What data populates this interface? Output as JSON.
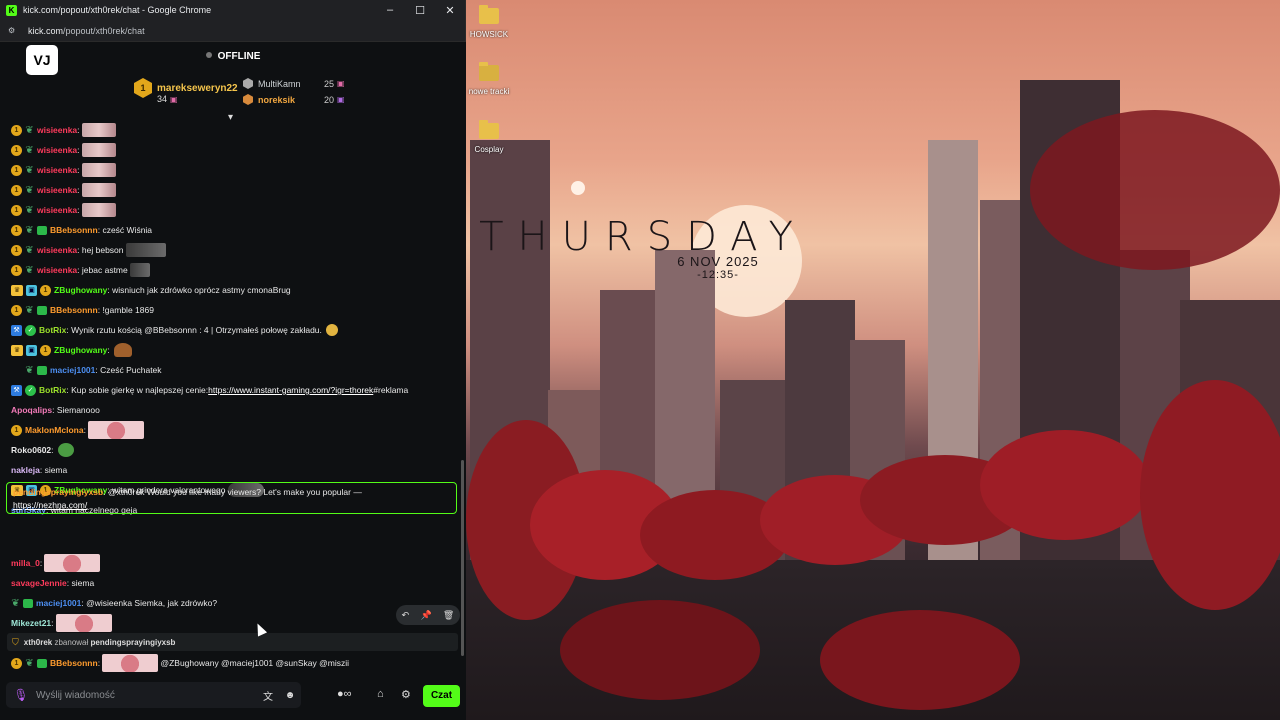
{
  "browser": {
    "title": "kick.com/popout/xth0rek/chat - Google Chrome",
    "url_host": "kick.com",
    "url_path": "/popout/xth0rek/chat"
  },
  "chat_header": {
    "status": "OFFLINE",
    "logo_text": "VJ"
  },
  "leaderboard": {
    "first": {
      "rank": "1",
      "name": "marekseweryn22",
      "points": "34"
    },
    "second": {
      "name": "MultiKamn",
      "points": "25"
    },
    "third": {
      "name": "noreksik",
      "points": "20"
    }
  },
  "messages": [
    {
      "user": "wisieenka",
      "text": ""
    },
    {
      "user": "wisieenka",
      "text": ""
    },
    {
      "user": "wisieenka",
      "text": ""
    },
    {
      "user": "wisieenka",
      "text": ""
    },
    {
      "user": "wisieenka",
      "text": ""
    },
    {
      "user": "BBebsonnn",
      "text": "cześć Wiśnia"
    },
    {
      "user": "wisieenka",
      "text": "hej bebson"
    },
    {
      "user": "wisieenka",
      "text": "jebac astme"
    },
    {
      "user": "ZBughowany",
      "text": "wisniuch jak zdrówko oprócz astmy cmonaBrug"
    },
    {
      "user": "BBebsonnn",
      "text": "!gamble 1869"
    },
    {
      "user": "BotRix",
      "text": "Wynik rzutu kością @BBebsonnn : 4 | Otrzymałeś połowę zakładu."
    },
    {
      "user": "ZBughowany",
      "text": ""
    },
    {
      "user": "maciej1001",
      "text": "Cześć Puchatek"
    },
    {
      "user": "BotRix",
      "text": "Kup sobie gierkę w najlepszej cenie: ",
      "link": "https://www.instant-gaming.com/?igr=thorek",
      "suffix": " #reklama"
    },
    {
      "user": "Apoqalips",
      "text": "Siemanooo"
    },
    {
      "user": "MaklonMclona",
      "text": ""
    },
    {
      "user": "Roko0602",
      "text": ""
    },
    {
      "user": "nakleja",
      "text": "siema"
    },
    {
      "user": "ZBughowany",
      "text": "witam grindera valorantowego"
    },
    {
      "user": "sunSkay",
      "text": "witam naczelnego geja"
    },
    {
      "user": "milla_0",
      "text": ""
    },
    {
      "user": "savageJennie",
      "text": "siema"
    },
    {
      "user": "maciej1001",
      "text": "@wisieenka Siemka, jak zdrówko?"
    },
    {
      "user": "Mikezet21",
      "text": ""
    },
    {
      "user": "BBebsonnn",
      "text": "@ZBughowany @maciej1001 @sunSkay @miszii"
    }
  ],
  "highlight": {
    "user": "pendingsprayingiyxsb",
    "text": "@xth0rek Would you like many viewers? Let's make you popular —",
    "link": "https://nezhna.com/"
  },
  "ban_notice": {
    "moderator": "xth0rek",
    "action": "zbanował",
    "target": "pendingsprayingiyxsb"
  },
  "input": {
    "placeholder": "Wyślij wiadomość",
    "send_label": "Czat"
  },
  "desktop": {
    "icons": [
      "HOWSICK",
      "nowe tracki",
      "Cosplay"
    ],
    "clock": {
      "day": "THURSDAY",
      "date": "6 NOV 2025",
      "time": "-12:35-"
    }
  },
  "colors": {
    "kick_green": "#53fc18",
    "gold": "#e2a71b",
    "chat_bg": "#0e1012"
  }
}
